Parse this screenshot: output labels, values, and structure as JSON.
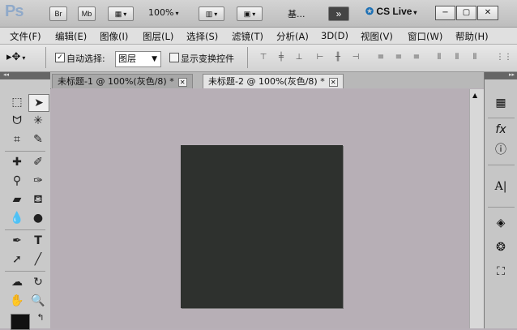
{
  "titlebar": {
    "logo": "Ps",
    "br": "Br",
    "mb": "Mb",
    "zoom": "100%",
    "workspace": "基...",
    "cs_live": "CS Live"
  },
  "menu": [
    "文件(F)",
    "编辑(E)",
    "图像(I)",
    "图层(L)",
    "选择(S)",
    "滤镜(T)",
    "分析(A)",
    "3D(D)",
    "视图(V)",
    "窗口(W)",
    "帮助(H)"
  ],
  "options": {
    "auto_select_label": "自动选择:",
    "auto_select_checked": true,
    "auto_select_value": "图层",
    "show_transform_label": "显示变换控件"
  },
  "tabs": [
    {
      "label": "未标题-1 @ 100%(灰色/8) *",
      "active": false
    },
    {
      "label": "未标题-2 @ 100%(灰色/8) *",
      "active": true
    }
  ],
  "colors": {
    "canvas_bg": "#b7afb6",
    "document": "#2e312e"
  }
}
